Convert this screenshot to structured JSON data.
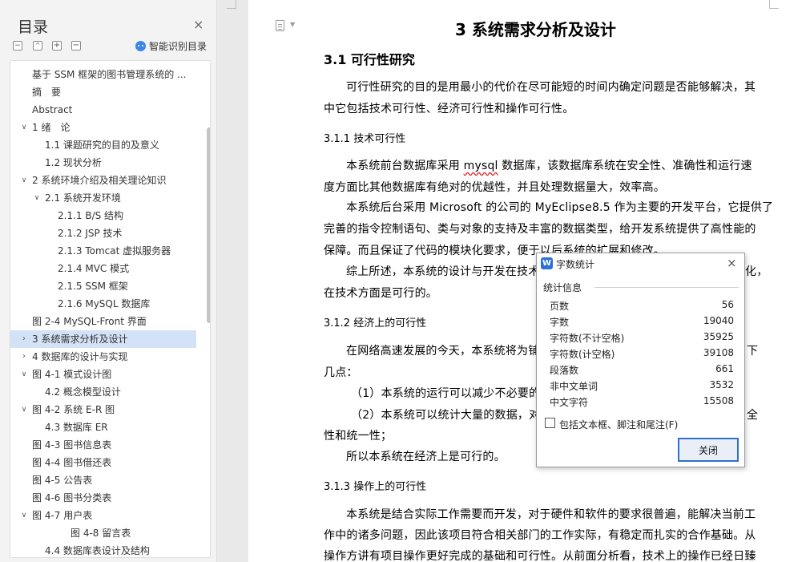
{
  "sidebar": {
    "title": "目录",
    "close": "×",
    "ctrl_collapse": "−",
    "ctrl_expand": "+",
    "ctrl_minus": "−",
    "smart_label": "智能识别目录",
    "items": [
      {
        "label": "基于 SSM 框架的图书管理系统的 ..."
      },
      {
        "label": "摘　要"
      },
      {
        "label": "Abstract"
      },
      {
        "label": "1  绪　论"
      },
      {
        "label": "1.1 课题研究的目的及意义"
      },
      {
        "label": "1.2  现状分析"
      },
      {
        "label": "2  系统环境介绍及相关理论知识"
      },
      {
        "label": "2.1  系统开发环境"
      },
      {
        "label": "2.1.1 B/S 结构"
      },
      {
        "label": "2.1.2 JSP 技术"
      },
      {
        "label": "2.1.3 Tomcat 虚拟服务器"
      },
      {
        "label": "2.1.4 MVC 模式"
      },
      {
        "label": "2.1.5 SSM 框架"
      },
      {
        "label": "2.1.6 MySQL 数据库"
      },
      {
        "label": "图  2-4 MySQL-Front 界面"
      },
      {
        "label": "3  系统需求分析及设计"
      },
      {
        "label": "4 数据库的设计与实现"
      },
      {
        "label": "图  4-1  模式设计图"
      },
      {
        "label": "4.2 概念模型设计"
      },
      {
        "label": "图  4-2  系统 E-R 图"
      },
      {
        "label": "4.3 数据库 ER"
      },
      {
        "label": "图 4-3  图书信息表"
      },
      {
        "label": "图 4-4  图书借还表"
      },
      {
        "label": "图 4-5  公告表"
      },
      {
        "label": "图 4-6  图书分类表"
      },
      {
        "label": "图  4-7  用户表"
      },
      {
        "label": "图 4-8  留言表"
      },
      {
        "label": "4.4 数据库表设计及结构"
      }
    ]
  },
  "document": {
    "chapter_title": "3  系统需求分析及设计",
    "section_31": "3.1  可行性研究",
    "para_intro_1": "可行性研究的目的是用最小的代价在尽可能短的时间内确定问题是否能够解决，其",
    "para_intro_2": "中它包括技术可行性、经济可行性和操作可行性。",
    "sub_311": "3.1.1  技术可行性",
    "p1_1a": "本系统前台数据库采用 ",
    "p1_1b": "mysql",
    "p1_1c": " 数据库，该数据库系统在安全性、准确性和运行速",
    "p1_2": "度方面比其他数据库有绝对的优越性，并且处理数据量大，效率高。",
    "p2_1": "本系统后台采用 Microsoft 的公司的 MyEclipse8.5 作为主要的开发平台，它提供了",
    "p2_2": "完善的指令控制语句、类与对象的支持及丰富的数据类型，给开发系统提供了高性能的",
    "p2_3": "保障。而且保证了代码的模块化要求，便于以后系统的扩展和修改。",
    "p3_1a": "综上所述，本系统的设计与开发在技术",
    "p3_1b": "化，",
    "p3_2": "在技术方面是可行的。",
    "sub_312": "3.1.2  经济上的可行性",
    "p4_1a": "在网络高速发展的今天，本系统将为铺",
    "p4_1b": "下",
    "p4_2": "几点：",
    "p5": "（1）本系统的运行可以减少不必要的",
    "p6a": "（2）本系统可以统计大量的数据，对",
    "p6b": "全",
    "p6_2": "性和统一性；",
    "p7": "所以本系统在经济上是可行的。",
    "sub_313": "3.1.3  操作上的可行性",
    "p8_1": "本系统是结合实际工作需要而开发，对于硬件和软件的要求很普遍，能解决当前工",
    "p8_2": "作中的诸多问题，因此该项目符合相关部门的工作实际，有稳定而扎实的合作基础。从",
    "p8_3": "操作方讲有项目操作更好完成的基础和可行性。从前面分析看，技术上的操作已经日臻"
  },
  "dialog": {
    "logo": "W",
    "title": "字数统计",
    "close": "×",
    "group_label": "统计信息",
    "stats": [
      {
        "label": "页数",
        "value": "56"
      },
      {
        "label": "字数",
        "value": "19040"
      },
      {
        "label": "字符数(不计空格)",
        "value": "35925"
      },
      {
        "label": "字符数(计空格)",
        "value": "39108"
      },
      {
        "label": "段落数",
        "value": "661"
      },
      {
        "label": "非中文单词",
        "value": "3532"
      },
      {
        "label": "中文字符",
        "value": "15508"
      }
    ],
    "checkbox_label": "包括文本框、脚注和尾注(F)",
    "checkbox_checked": false,
    "close_button": "关闭"
  },
  "colors": {
    "accent": "#2f6fd1",
    "toc_active": "#d4e2f7",
    "spell_error": "#d33333"
  }
}
